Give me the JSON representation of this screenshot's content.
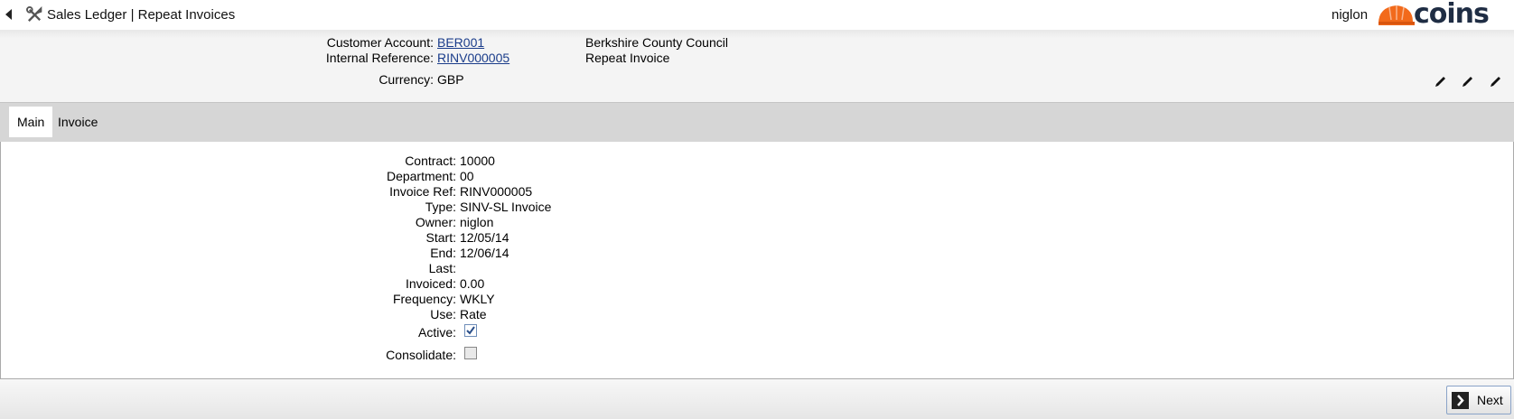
{
  "topbar": {
    "title": "Sales Ledger | Repeat Invoices",
    "user": "niglon",
    "logo_text": "COINS"
  },
  "header": {
    "customer_account_label": "Customer Account:",
    "customer_account_value": "BER001",
    "customer_name": "Berkshire County Council",
    "internal_reference_label": "Internal Reference:",
    "internal_reference_value": "RINV000005",
    "internal_reference_desc": "Repeat Invoice",
    "currency_label": "Currency:",
    "currency_value": "GBP"
  },
  "tabs": [
    {
      "label": "Main",
      "active": true
    },
    {
      "label": "Invoice",
      "active": false
    }
  ],
  "fields": [
    {
      "label": "Contract:",
      "value": "10000"
    },
    {
      "label": "Department:",
      "value": "00"
    },
    {
      "label": "Invoice Ref:",
      "value": "RINV000005"
    },
    {
      "label": "Type:",
      "value": "SINV-SL Invoice"
    },
    {
      "label": "Owner:",
      "value": "niglon"
    },
    {
      "label": "Start:",
      "value": "12/05/14"
    },
    {
      "label": "End:",
      "value": "12/06/14"
    },
    {
      "label": "Last:",
      "value": ""
    },
    {
      "label": "Invoiced:",
      "value": "0.00"
    },
    {
      "label": "Frequency:",
      "value": "WKLY"
    },
    {
      "label": "Use:",
      "value": "Rate"
    }
  ],
  "checkboxes": {
    "active_label": "Active:",
    "active_checked": true,
    "consolidate_label": "Consolidate:",
    "consolidate_checked": false
  },
  "footer": {
    "next_label": "Next"
  },
  "colors": {
    "link": "#1a3c8a",
    "logo_orange": "#f26a1b",
    "logo_navy": "#1f2d44"
  }
}
